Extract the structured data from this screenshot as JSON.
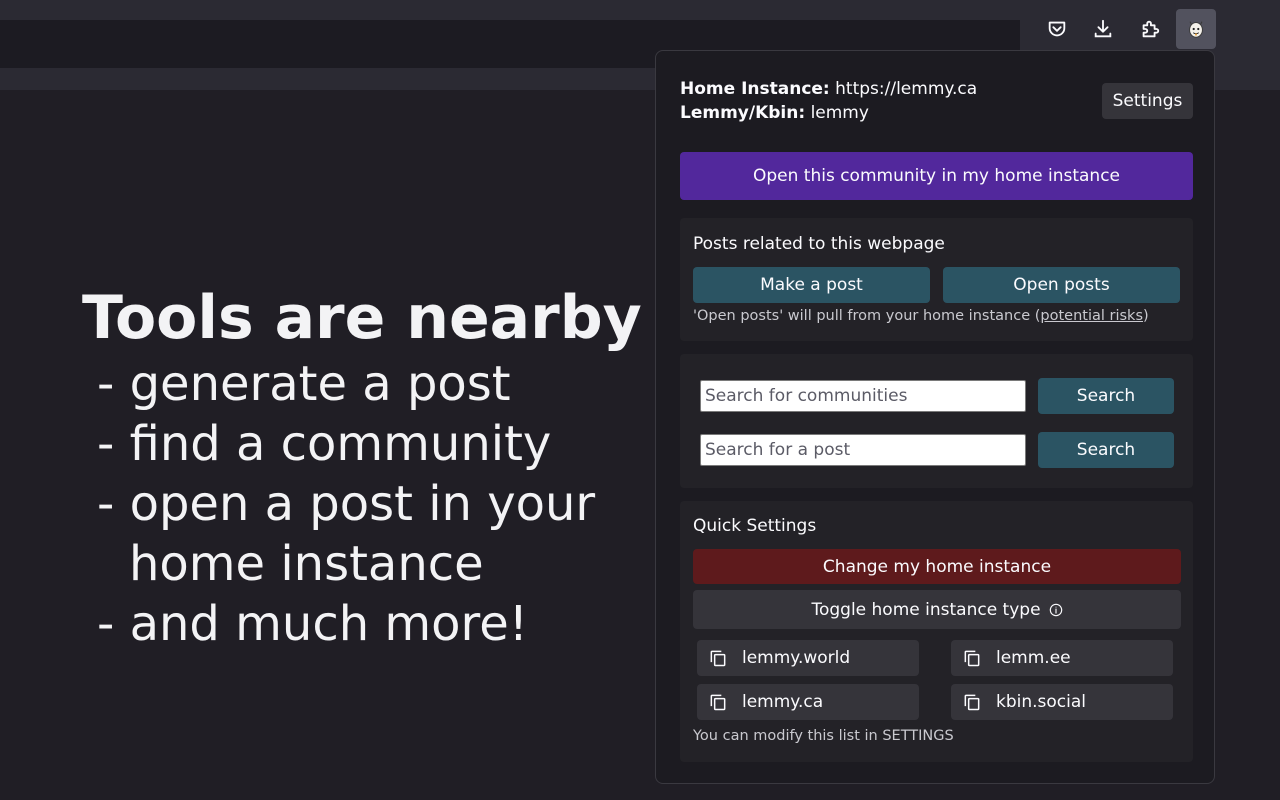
{
  "toolbar": {
    "icons": [
      "pocket-icon",
      "download-icon",
      "extensions-icon",
      "lemmy-extension-icon"
    ]
  },
  "promo": {
    "title": "Tools are nearby",
    "items": [
      "- generate a post",
      "- find a community",
      "- open a post in your",
      "home instance",
      "- and much more!"
    ]
  },
  "popup": {
    "home_instance_label": "Home Instance:",
    "home_instance_value": "https://lemmy.ca",
    "type_label": "Lemmy/Kbin:",
    "type_value": "lemmy",
    "settings_label": "Settings",
    "open_community_label": "Open this community in my home instance",
    "posts": {
      "title": "Posts related to this webpage",
      "make_post_label": "Make a post",
      "open_posts_label": "Open posts",
      "note_prefix": "'Open posts' will pull from your home instance (",
      "note_link": "potential risks",
      "note_suffix": ")"
    },
    "search": {
      "communities_placeholder": "Search for communities",
      "posts_placeholder": "Search for a post",
      "search_label": "Search"
    },
    "quick": {
      "title": "Quick Settings",
      "change_home_label": "Change my home instance",
      "toggle_type_label": "Toggle home instance type",
      "instances": [
        "lemmy.world",
        "lemm.ee",
        "lemmy.ca",
        "kbin.social"
      ],
      "footer_note": "You can modify this list in SETTINGS"
    }
  },
  "colors": {
    "accent_purple": "#52289c",
    "teal_button": "#2b5463",
    "danger_red": "#5e1a1c",
    "panel_bg": "#1c1b21"
  }
}
